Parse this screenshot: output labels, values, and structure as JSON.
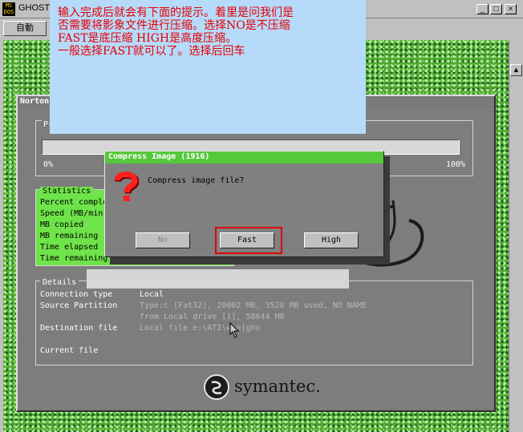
{
  "window": {
    "title": "GHOST",
    "icon_text": "MS DOS",
    "controls": {
      "minimize": "_",
      "maximize": "□",
      "close": "×"
    }
  },
  "toolbar": {
    "auto_label": "自動"
  },
  "annotation": {
    "lines": [
      "输入完成后就会有下面的提示。着里是问我们是",
      "否需要将影象文件进行压缩。选择NO是不压缩",
      "FAST是底压缩 HIGH是高度压缩。",
      "一般选择FAST就可以了。选择后回车"
    ]
  },
  "ghost": {
    "title": "Norton",
    "progress": {
      "label": "Pr",
      "min": "0%",
      "max": "100%",
      "value": 0
    },
    "statistics": {
      "title": "Statistics",
      "labels": [
        "Percent complete",
        "Speed (MB/min)",
        "MB copied",
        "MB remaining",
        "Time elapsed",
        "Time remaining"
      ]
    },
    "details": {
      "title": "Details",
      "rows": [
        {
          "label": "Connection type",
          "value": "Local"
        },
        {
          "label": "Source Partition",
          "value": "Type:c [Fat32], 20002 MB, 3520 MB used, NO NAME"
        },
        {
          "label": "",
          "value": "from Local drive [1], 58644 MB"
        },
        {
          "label": "Destination file",
          "value": "Local file e:\\ATI\\win|gho"
        },
        {
          "label": "Current file",
          "value": ""
        }
      ]
    },
    "logo_text": "symantec."
  },
  "dialog": {
    "title": "Compress Image (1916)",
    "message": "Compress image file?",
    "buttons": {
      "no": "No",
      "fast": "Fast",
      "high": "High"
    }
  },
  "colors": {
    "annotation_bg": "#b6dafa",
    "annotation_text": "#e60000",
    "highlight": "#e00000",
    "stats_bg": "#6ee34a",
    "dialog_titlebar": "#56c83b"
  }
}
